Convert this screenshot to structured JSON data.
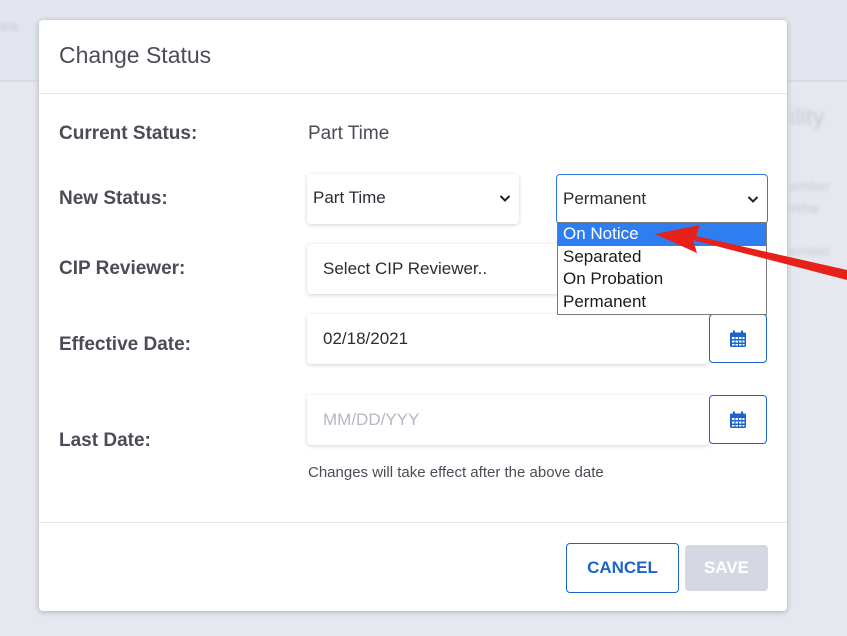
{
  "dialog": {
    "title": "Change Status",
    "current_status_label": "Current Status:",
    "current_status_value": "Part Time",
    "new_status_label": "New Status:",
    "new_status_employment_value": "Part Time",
    "new_status_type_value": "Permanent",
    "cip_reviewer_label": "CIP Reviewer:",
    "cip_reviewer_placeholder": "Select CIP Reviewer..",
    "effective_date_label": "Effective Date:",
    "effective_date_value": "02/18/2021",
    "last_date_label": "Last Date:",
    "last_date_placeholder": "MM/DD/YYY",
    "hint_text": "Changes will take effect after the above date",
    "cancel_label": "CANCEL",
    "save_label": "SAVE"
  },
  "dropdown": {
    "options": [
      "On Notice",
      "Separated",
      "On Probation",
      "Permanent"
    ],
    "highlighted": "On Notice"
  },
  "colors": {
    "accent": "#1d64c9",
    "highlight": "#2e7ef2",
    "annotation_arrow": "#e8201a",
    "save_disabled": "#d5d8e2"
  },
  "icons": {
    "calendar": "calendar-icon",
    "chevron": "chevron-down-icon"
  }
}
